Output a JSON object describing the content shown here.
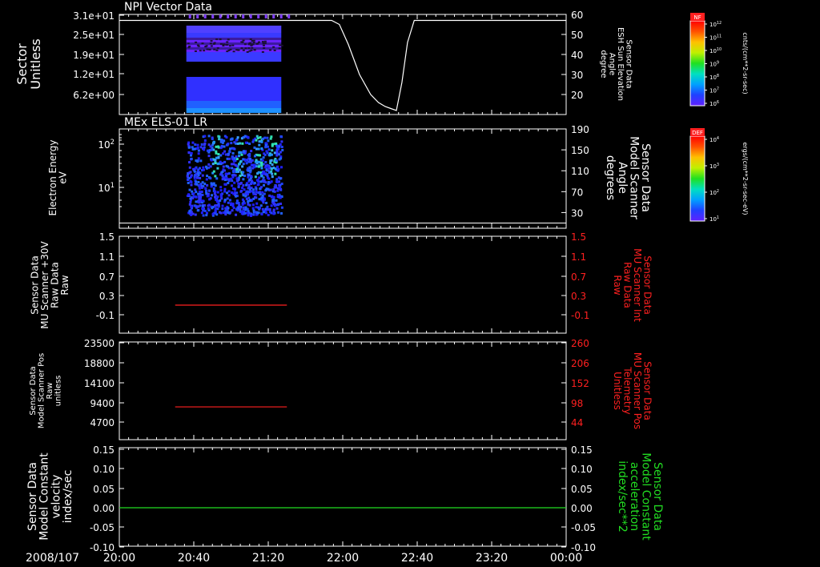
{
  "title": "NPI Vector Data",
  "panel2_title": "MEx ELS-01 LR",
  "date_label": "2008/107",
  "time_ticks": [
    "20:00",
    "20:40",
    "21:20",
    "22:00",
    "22:40",
    "23:20",
    "00:00"
  ],
  "time_tick_hours": [
    0,
    0.6667,
    1.3333,
    2.0,
    2.6667,
    3.3333,
    4.0
  ],
  "colors": {
    "white": "#ffffff",
    "red": "#ff2020",
    "green": "#22dd22",
    "bg": "#000000"
  },
  "colorbars": [
    {
      "title": "NF",
      "unit": "cnts/(cm**2-sr-sec)",
      "ticks": [
        "10^12",
        "10^11",
        "10^10",
        "10^9",
        "10^8",
        "10^7",
        "10^6"
      ]
    },
    {
      "title": "DEF",
      "unit": "ergs/(cm**2-sr-sec-eV)",
      "ticks": [
        "10^4",
        "10^3",
        "10^2",
        "10^1"
      ]
    }
  ],
  "panels": [
    {
      "left_label": [
        "Sector",
        "Unitless"
      ],
      "right_label": [
        "Sensor Data",
        "ESH Sun Elevation",
        "Angle",
        "degree"
      ],
      "left_ticks": [
        "3.1e+01",
        "2.5e+01",
        "1.9e+01",
        "1.2e+01",
        "6.2e+00"
      ],
      "right_ticks": [
        "60",
        "50",
        "40",
        "30",
        "20"
      ]
    },
    {
      "left_label": [
        "Electron Energy",
        "eV"
      ],
      "right_label": [
        "Sensor Data",
        "Model Scanner",
        "Angle",
        "degrees"
      ],
      "left_ticks": [
        "10^2",
        "10^1"
      ],
      "right_ticks": [
        "190",
        "150",
        "110",
        "70",
        "30"
      ]
    },
    {
      "left_label": [
        "Sensor Data",
        "MU Scanner +30V",
        "Raw Data",
        "Raw"
      ],
      "right_label": [
        "Sensor Data",
        "MU Scanner Int",
        "Raw Data",
        "Raw"
      ],
      "left_ticks": [
        "1.5",
        "1.1",
        "0.7",
        "0.3",
        "-0.1"
      ],
      "right_ticks": [
        "1.5",
        "1.1",
        "0.7",
        "0.3",
        "-0.1"
      ]
    },
    {
      "left_label": [
        "Sensor Data",
        "Model Scanner Pos",
        "Raw",
        "unitless"
      ],
      "right_label": [
        "Sensor Data",
        "MU Scanner Pos",
        "Telemetry",
        "Unitless"
      ],
      "left_ticks": [
        "23500",
        "18800",
        "14100",
        "9400",
        "4700"
      ],
      "right_ticks": [
        "260",
        "206",
        "152",
        "98",
        "44"
      ]
    },
    {
      "left_label": [
        "Sensor Data",
        "Model Constant",
        "velocity",
        "index/sec"
      ],
      "right_label": [
        "Sensor Data",
        "Model Constant",
        "acceleration",
        "index/sec**2"
      ],
      "left_ticks": [
        "0.15",
        "0.10",
        "0.05",
        "0.00",
        "-0.05",
        "-0.10"
      ],
      "right_ticks": [
        "0.15",
        "0.10",
        "0.05",
        "0.00",
        "-0.05",
        "-0.10"
      ]
    }
  ],
  "chart_data": [
    {
      "type": "heatmap",
      "panel": 1,
      "description_series": "Sector vs time spectrogram",
      "x_range_hours": [
        0,
        4
      ],
      "data_extent_hours": [
        0.6,
        1.45
      ],
      "bands": [
        [
          0.5,
          16.5
        ],
        [
          18.5,
          31
        ]
      ],
      "line_series": {
        "y_axis": "right",
        "ylim": [
          10,
          60
        ],
        "x": [
          0,
          1.8,
          1.9,
          1.97,
          2.05,
          2.15,
          2.25,
          2.32,
          2.38,
          2.43,
          2.48,
          2.53,
          2.58,
          2.64,
          4.0
        ],
        "y": [
          57,
          57,
          57,
          55,
          45,
          30,
          20,
          16,
          14,
          13,
          12,
          26,
          46,
          57,
          57
        ]
      }
    },
    {
      "type": "heatmap",
      "panel": 2,
      "x_range_hours": [
        0,
        4
      ],
      "data_extent_hours": [
        0.6,
        1.45
      ],
      "ylog": true,
      "line_series": {
        "y_axis": "right",
        "ylim": [
          0,
          190
        ],
        "x": [
          0,
          4
        ],
        "y": [
          10,
          10
        ]
      }
    },
    {
      "type": "line",
      "panel": 3,
      "ylim": [
        -0.3,
        1.5
      ],
      "series": [
        {
          "x": [
            0.5,
            1.5
          ],
          "y": [
            0.1,
            0.1
          ]
        }
      ]
    },
    {
      "type": "line",
      "panel": 4,
      "ylim": [
        0,
        23500
      ],
      "series": [
        {
          "x": [
            0.5,
            1.5
          ],
          "y": [
            8300,
            8300
          ]
        }
      ]
    },
    {
      "type": "line",
      "panel": 5,
      "ylim": [
        -0.1,
        0.15
      ],
      "series": [
        {
          "x": [
            0,
            4
          ],
          "y": [
            0.0,
            0.0
          ]
        }
      ]
    }
  ]
}
